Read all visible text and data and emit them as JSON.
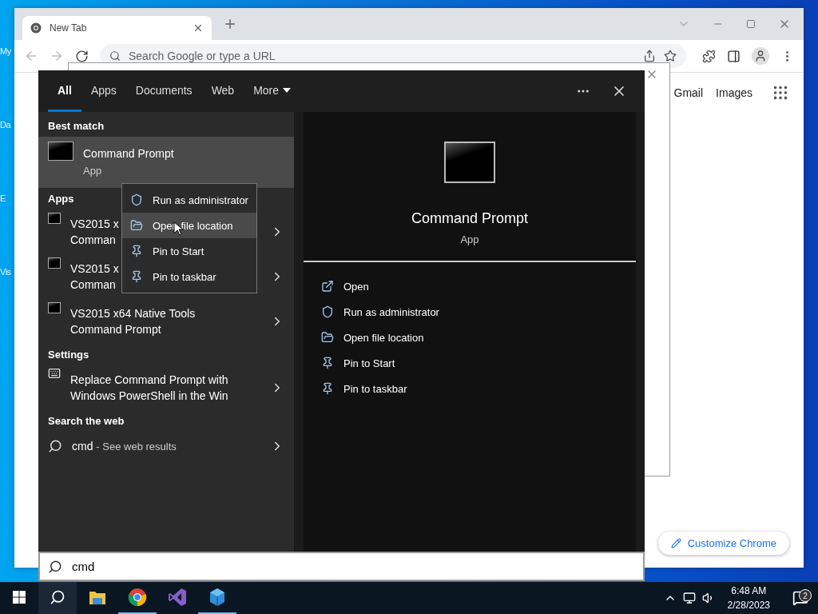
{
  "desktop_icons": [
    {
      "label": "My"
    },
    {
      "label": "Da"
    },
    {
      "label": "E"
    },
    {
      "label": "Vis"
    }
  ],
  "browser": {
    "tabs": [
      {
        "title": "New Tab",
        "selected": true
      }
    ],
    "address_placeholder": "Search Google or type a URL",
    "links": [
      "Gmail",
      "Images"
    ],
    "customize_button": "Customize Chrome"
  },
  "search_panel": {
    "filters": [
      {
        "label": "All",
        "selected": true,
        "kind": "tab"
      },
      {
        "label": "Apps",
        "selected": false,
        "kind": "tab"
      },
      {
        "label": "Documents",
        "selected": false,
        "kind": "tab"
      },
      {
        "label": "Web",
        "selected": false,
        "kind": "tab"
      },
      {
        "label": "More",
        "selected": false,
        "kind": "dropdown"
      }
    ],
    "sections": [
      {
        "heading": "Best match",
        "results": [
          {
            "kind": "best",
            "lines": [
              "Command Prompt"
            ],
            "subtitle": "App",
            "selected": true
          }
        ]
      },
      {
        "heading": "Apps",
        "results": [
          {
            "kind": "console",
            "lines": [
              "VS2015 x",
              "Comman"
            ],
            "selected": false
          },
          {
            "kind": "console",
            "lines": [
              "VS2015 x",
              "Comman"
            ],
            "selected": false
          },
          {
            "kind": "console",
            "lines": [
              "VS2015 x64 Native Tools",
              "Command Prompt"
            ],
            "selected": false
          }
        ]
      },
      {
        "heading": "Settings",
        "results": [
          {
            "kind": "settings",
            "lines": [
              "Replace Command Prompt with",
              "Windows PowerShell in the Win"
            ],
            "selected": false
          }
        ]
      },
      {
        "heading": "Search the web",
        "results": [
          {
            "kind": "web",
            "lines": [
              "cmd"
            ],
            "suffix": "- See web results",
            "selected": false
          }
        ]
      }
    ],
    "preview": {
      "title": "Command Prompt",
      "subtitle": "App",
      "actions": [
        {
          "label": "Open",
          "kind": "open"
        },
        {
          "label": "Run as administrator",
          "kind": "admin"
        },
        {
          "label": "Open file location",
          "kind": "location"
        },
        {
          "label": "Pin to Start",
          "kind": "pin"
        },
        {
          "label": "Pin to taskbar",
          "kind": "pin"
        }
      ]
    },
    "query": "cmd"
  },
  "context_menu": {
    "items": [
      {
        "label": "Run as administrator",
        "kind": "admin",
        "hovered": false
      },
      {
        "label": "Open file location",
        "kind": "location",
        "hovered": true
      },
      {
        "label": "Pin to Start",
        "kind": "pin",
        "hovered": false
      },
      {
        "label": "Pin to taskbar",
        "kind": "pin",
        "hovered": false
      }
    ]
  },
  "taskbar": {
    "apps": [
      {
        "kind": "explorer",
        "running": false
      },
      {
        "kind": "chrome",
        "running": true
      },
      {
        "kind": "studio",
        "running": false
      },
      {
        "kind": "cube",
        "running": true
      }
    ],
    "time": "6:48 AM",
    "date": "2/28/2023",
    "notifications": "2"
  }
}
